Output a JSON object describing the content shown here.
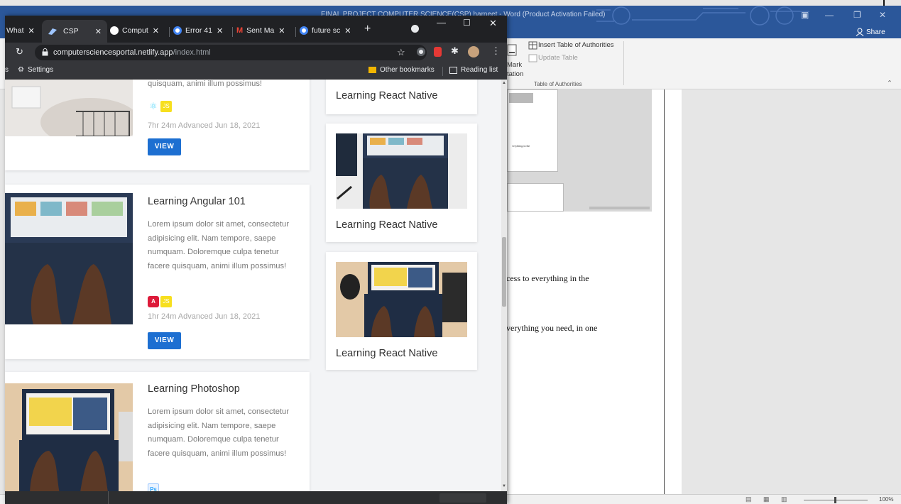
{
  "word": {
    "title": "FINAL PROJECT COMPUTER SCIENCE(CSP) harneet - Word (Product Activation Failed)",
    "share_label": "Share",
    "ribbon": {
      "insert_toa": "Insert Table of Authorities",
      "update_table": "Update Table",
      "mark": "Mark",
      "tation": "tation",
      "group_label": "Table of Authorities"
    },
    "doc_lines": [
      "cess to everything in the",
      "verything you need, in one"
    ],
    "thumb_text": "verything in the",
    "zoom_level": "100%"
  },
  "chrome": {
    "tabs": [
      {
        "label": "What",
        "icon": "whatsapp-icon"
      },
      {
        "label": "CSP",
        "icon": "csp-icon"
      },
      {
        "label": "Comput",
        "icon": "github-icon"
      },
      {
        "label": "Error 41",
        "icon": "google-icon"
      },
      {
        "label": "Sent Ma",
        "icon": "gmail-icon"
      },
      {
        "label": "future sc",
        "icon": "google-icon"
      }
    ],
    "new_tab": "+",
    "url_host": "computersciencesportal.netlify.app",
    "url_path": "/index.html",
    "bookmarks": {
      "settings": "Settings",
      "other": "Other bookmarks",
      "reading": "Reading list"
    }
  },
  "page": {
    "course_cards": [
      {
        "title": "",
        "desc_tail": "quisquam, animi illum possimus!",
        "meta": "7hr 24m   Advanced   Jun 18, 2021",
        "view": "VIEW"
      },
      {
        "title": "Learning Angular 101",
        "desc": "Lorem ipsum dolor sit amet, consectetur adipisicing elit. Nam tempore, saepe numquam. Doloremque culpa tenetur facere quisquam, animi illum possimus!",
        "meta": "1hr 24m   Advanced   Jun 18, 2021",
        "view": "VIEW"
      },
      {
        "title": "Learning Photoshop",
        "desc": "Lorem ipsum dolor sit amet, consectetur adipisicing elit. Nam tempore, saepe numquam. Doloremque culpa tenetur facere quisquam, animi illum possimus!"
      }
    ],
    "side_cards": [
      {
        "title": "Learning React Native"
      },
      {
        "title": "Learning React Native"
      },
      {
        "title": "Learning React Native"
      }
    ],
    "badges": {
      "js": "JS",
      "angular": "A",
      "ps": "Ps",
      "react": "⚛"
    }
  }
}
